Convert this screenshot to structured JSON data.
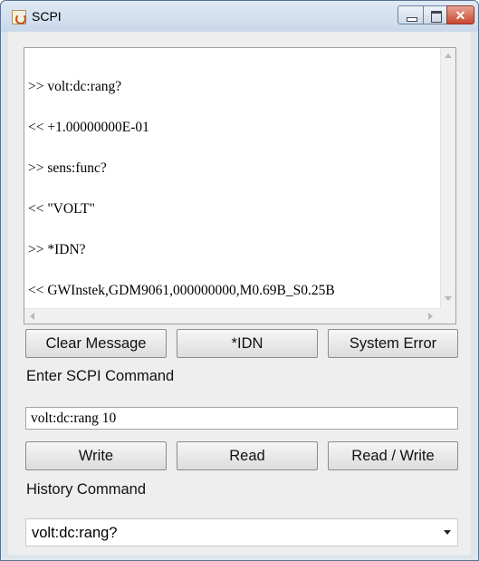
{
  "window": {
    "title": "SCPI",
    "icon": "java-app-icon",
    "controls": {
      "minimize": "minimize-icon",
      "maximize": "maximize-icon",
      "close": "close-icon"
    }
  },
  "messages": [
    ">> volt:dc:rang?",
    "<< +1.00000000E-01",
    ">> sens:func?",
    "<< \"VOLT\"",
    ">> *IDN?",
    "<< GWInstek,GDM9061,000000000,M0.69B_S0.25B"
  ],
  "buttons": {
    "clear": "Clear Message",
    "idn": "*IDN",
    "system_error": "System Error",
    "write": "Write",
    "read": "Read",
    "read_write": "Read / Write"
  },
  "command": {
    "label": "Enter SCPI Command",
    "value": "volt:dc:rang 10"
  },
  "history": {
    "label": "History Command",
    "selected": "volt:dc:rang?"
  }
}
